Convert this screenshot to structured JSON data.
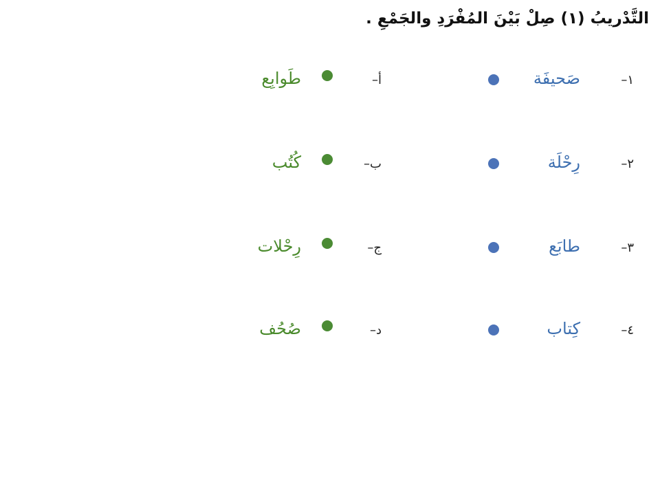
{
  "exercise": {
    "title": "التَّدْريبُ (١) صِلْ بَيْنَ المُفْرَدِ والجَمْعِ ."
  },
  "rows": [
    {
      "num": "١–",
      "singular": "صَحيفَة",
      "letter": "أ–",
      "plural": "طَوابِع"
    },
    {
      "num": "٢–",
      "singular": "رِحْلَة",
      "letter": "ب–",
      "plural": "كُتُب"
    },
    {
      "num": "٣–",
      "singular": "طابَع",
      "letter": "ج–",
      "plural": "رِحْلات"
    },
    {
      "num": "٤–",
      "singular": "كِتاب",
      "letter": "د–",
      "plural": "صُحُف"
    }
  ],
  "colors": {
    "singular_text": "#3d6fb0",
    "plural_text": "#4a8a2c",
    "singular_dot": "#4c73b8",
    "plural_dot": "#4b8b34"
  }
}
